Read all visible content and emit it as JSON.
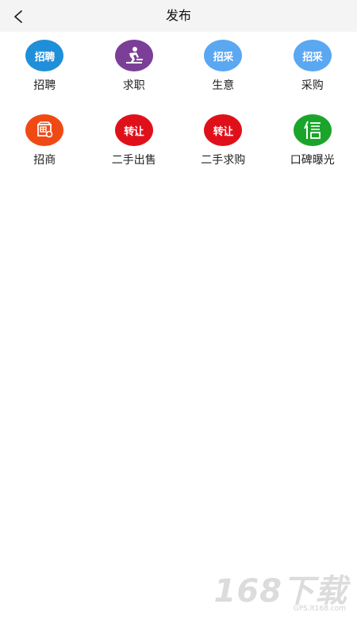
{
  "header": {
    "title": "发布"
  },
  "items": [
    {
      "label": "招聘",
      "icon_text": "招聘",
      "icon": "recruit-icon",
      "color": "#1f8fd9"
    },
    {
      "label": "求职",
      "icon_text": "",
      "icon": "worker-icon",
      "color": "#7b3f98"
    },
    {
      "label": "生意",
      "icon_text": "招采",
      "icon": "business-icon",
      "color": "#5aa7f2"
    },
    {
      "label": "采购",
      "icon_text": "招采",
      "icon": "purchase-icon",
      "color": "#5aa7f2"
    },
    {
      "label": "招商",
      "icon_text": "",
      "icon": "shop-icon",
      "color": "#f04a14"
    },
    {
      "label": "二手出售",
      "icon_text": "转让",
      "icon": "transfer-sell-icon",
      "color": "#e0101a"
    },
    {
      "label": "二手求购",
      "icon_text": "转让",
      "icon": "transfer-buy-icon",
      "color": "#e0101a"
    },
    {
      "label": "口碑曝光",
      "icon_text": "",
      "icon": "reputation-icon",
      "color": "#1aa52a"
    }
  ],
  "watermark": {
    "big": "168下载",
    "small": "GPS.lt168.com"
  }
}
